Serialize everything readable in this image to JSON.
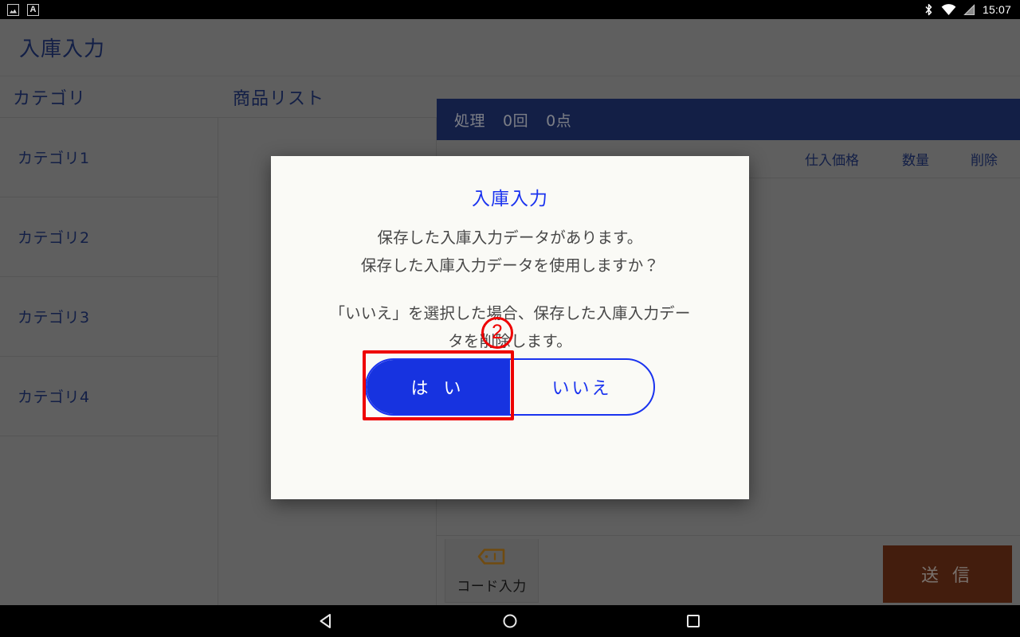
{
  "statusbar": {
    "time": "15:07",
    "left_icons": [
      "screenshot-icon",
      "input-method-icon"
    ],
    "left_letter": "A",
    "right_icons": [
      "bluetooth-icon",
      "wifi-icon",
      "signal-icon"
    ]
  },
  "header": {
    "title": "入庫入力"
  },
  "tabs": [
    {
      "label": "カテゴリ",
      "name": "tab-category"
    },
    {
      "label": "商品リスト",
      "name": "tab-product-list"
    }
  ],
  "categories": [
    {
      "label": "カテゴリ1"
    },
    {
      "label": "カテゴリ2"
    },
    {
      "label": "カテゴリ3"
    },
    {
      "label": "カテゴリ4"
    }
  ],
  "process_bar": {
    "label": "処理",
    "count": "0回",
    "items": "0点"
  },
  "table": {
    "columns": [
      "仕入価格",
      "数量",
      "削除"
    ],
    "rows": []
  },
  "bottom_toolbar": {
    "code_input_label": "コード入力",
    "send_label": "送 信"
  },
  "dialog": {
    "title": "入庫入力",
    "message_line1": "保存した入庫入力データがあります。",
    "message_line2": "保存した入庫入力データを使用しますか？",
    "message_line3": "「いいえ」を選択した場合、保存した入庫入力デー",
    "message_line4": "タを削除します。",
    "yes_label": "は い",
    "no_label": "いいえ"
  },
  "annotation": {
    "step_number": "2",
    "target": "yes-button"
  },
  "navbar": {
    "back": "back-icon",
    "home": "home-icon",
    "recents": "recents-icon"
  },
  "colors": {
    "accent_blue": "#1f3372",
    "dialog_blue": "#1a33ef",
    "annotation_red": "#ee0000",
    "send_button": "#6d2f16",
    "panel_gray": "#9a9a9a"
  }
}
